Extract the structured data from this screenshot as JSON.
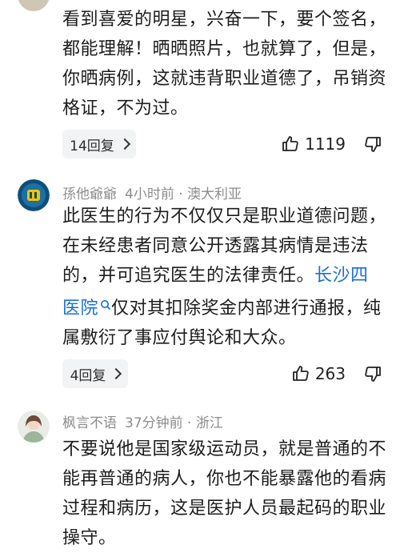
{
  "comments": [
    {
      "text": "看到喜爱的明星，兴奋一下，要个签名，都能理解！晒晒照片，也就算了，但是，你晒病例，这就违背职业道德了，吊销资格证，不为过。",
      "reply_label": "14回复",
      "likes": "1119"
    },
    {
      "name": "孫他爺爺",
      "time": "4小时前",
      "location": "澳大利亚",
      "text_before": "此医生的行为不仅仅只是职业道德问题，在未经患者同意公开透露其病情是违法的，并可追究医生的法律责任。",
      "link_text": "长沙四医院",
      "text_after": "仅对其扣除奖金内部进行通报，纯属敷衍了事应付舆论和大众。",
      "reply_label": "4回复",
      "likes": "263"
    },
    {
      "name": "枫言不语",
      "time": "37分钟前",
      "location": "浙江",
      "text": "不要说他是国家级运动员，就是普通的不能再普通的病人，你也不能暴露他的看病过程和病历，这是医护人员最起码的职业操守。"
    }
  ],
  "separator": "·",
  "colors": {
    "link": "#1a6fd6",
    "meta": "#8c8c8c",
    "reply_bg": "#f2f3f5"
  }
}
